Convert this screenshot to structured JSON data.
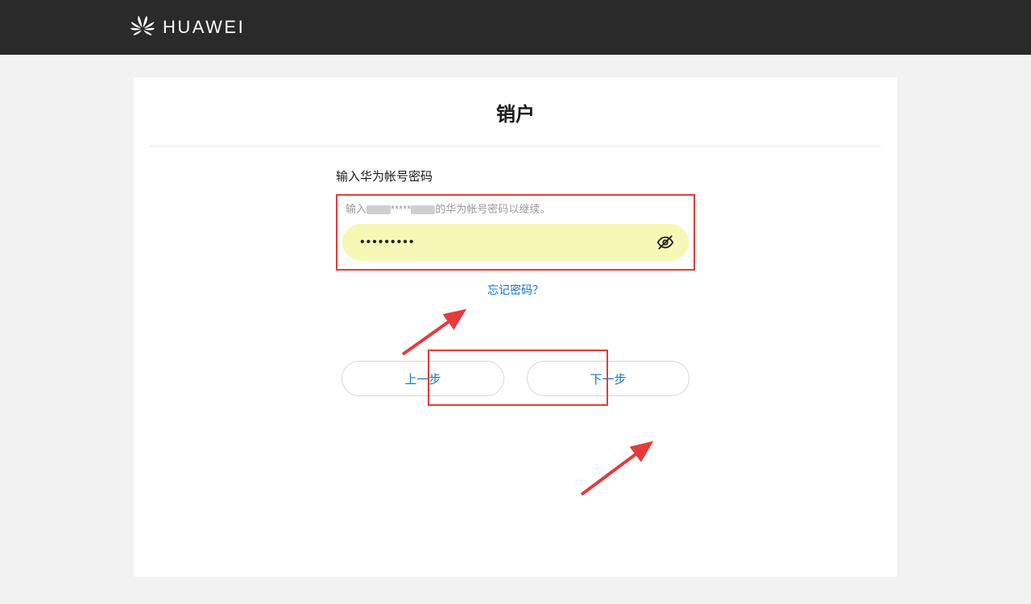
{
  "header": {
    "brand": "HUAWEI"
  },
  "page": {
    "title": "销户"
  },
  "form": {
    "section_label": "输入华为帐号密码",
    "hint_prefix": "输入",
    "hint_mid": "*****",
    "hint_suffix": "的华为帐号密码以继续。",
    "password_value": "•••••••••",
    "forgot_label": "忘记密码？"
  },
  "buttons": {
    "prev": "上一步",
    "next": "下一步"
  }
}
